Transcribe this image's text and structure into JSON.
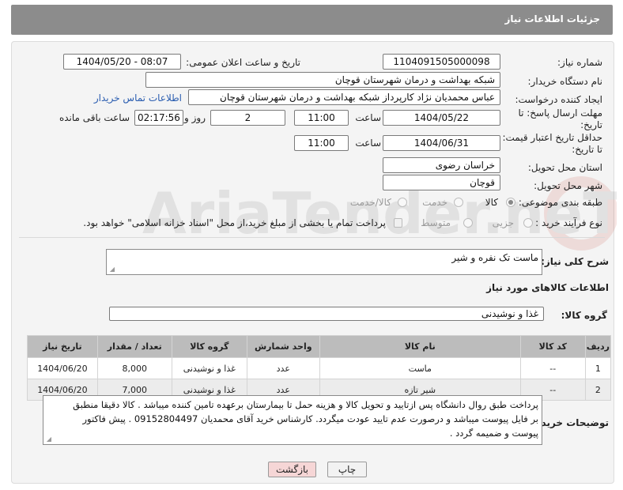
{
  "header": {
    "title": "جزئیات اطلاعات نیاز"
  },
  "fields": {
    "need_number_label": "شماره نیاز:",
    "need_number": "1104091505000098",
    "announce_label": "تاریخ و ساعت اعلان عمومی:",
    "announce_value": "1404/05/20 - 08:07",
    "buyer_org_label": "نام دستگاه خریدار:",
    "buyer_org": "شبکه بهداشت و درمان شهرستان قوچان",
    "requester_label": "ایجاد کننده درخواست:",
    "requester": "عباس محمدیان نژاد کارپرداز شبکه بهداشت و درمان شهرستان قوچان",
    "contact_link": "اطلاعات تماس خریدار",
    "deadline_label_1": "مهلت ارسال پاسخ: تا",
    "deadline_label_2": "تاریخ:",
    "deadline_date": "1404/05/22",
    "hour_label": "ساعت",
    "deadline_hour": "11:00",
    "days_value": "2",
    "days_label": "روز و",
    "remaining_time": "02:17:56",
    "remaining_label": "ساعت باقی مانده",
    "min_validity_label_1": "حداقل تاریخ اعتبار قیمت:",
    "min_validity_label_2": "تا تاریخ:",
    "validity_date": "1404/06/31",
    "validity_hour": "11:00",
    "province_label": "استان محل تحویل:",
    "province": "خراسان رضوی",
    "city_label": "شهر محل تحویل:",
    "city": "قوچان",
    "category_label": "طبقه بندی موضوعی:",
    "category_options": [
      "کالا",
      "خدمت",
      "کالا/خدمت"
    ],
    "purchase_type_label": "نوع فرآیند خرید :",
    "purchase_options": [
      "جزیی",
      "متوسط"
    ],
    "payment_note": "پرداخت تمام یا بخشی از مبلغ خرید،از محل \"اسناد خزانه اسلامی\" خواهد بود."
  },
  "summary": {
    "label": "شرح کلی نیاز:",
    "value": "ماست تک نفره و شیر"
  },
  "goods_info_title": "اطلاعات کالاهای مورد نیاز",
  "goods_group": {
    "label": "گروه کالا:",
    "value": "غذا و نوشیدنی"
  },
  "table": {
    "headers": [
      "ردیف",
      "کد کالا",
      "نام کالا",
      "واحد شمارش",
      "گروه کالا",
      "تعداد / مقدار",
      "تاریخ نیاز"
    ],
    "rows": [
      [
        "1",
        "--",
        "ماست",
        "عدد",
        "غذا و نوشیدنی",
        "8,000",
        "1404/06/20"
      ],
      [
        "2",
        "--",
        "شیر تازه",
        "عدد",
        "غذا و نوشیدنی",
        "7,000",
        "1404/06/20"
      ]
    ]
  },
  "buyer_notes": {
    "label": "توضیحات خریدار:",
    "lines": [
      "پرداخت طبق روال دانشگاه پس ازتایید و تحویل کالا  و هزینه حمل تا بیمارستان برعهده تامین کننده میباشد . کالا دقیقا منطبق",
      "بر فایل پیوست میباشد و درصورت عدم تایید عودت میگردد. کارشناس خرید آقای محمدیان 09152804497 . پیش فاکتور",
      "پیوست و ضمیمه گردد ."
    ]
  },
  "buttons": {
    "print": "چاپ",
    "back": "بازگشت"
  },
  "watermark": "AriaTender.neT",
  "colors": {
    "header_bg": "#8c8c8c",
    "link": "#2a5db0",
    "back_btn": "#f6d6d6"
  }
}
